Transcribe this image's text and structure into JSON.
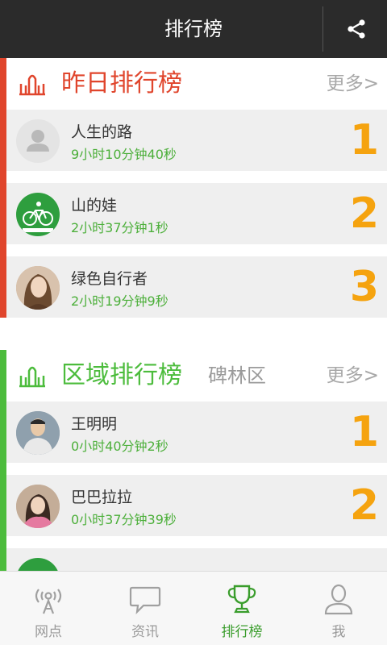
{
  "header": {
    "title": "排行榜",
    "share_icon": "share-icon"
  },
  "yesterday": {
    "title": "昨日排行榜",
    "more": "更多>",
    "accent": "#e0452c",
    "items": [
      {
        "name": "人生的路",
        "time": "9小时10分钟40秒",
        "rank": "1",
        "avatar": "default-avatar"
      },
      {
        "name": "山的娃",
        "time": "2小时37分钟1秒",
        "rank": "2",
        "avatar": "bicycle-avatar"
      },
      {
        "name": "绿色自行者",
        "time": "2小时19分钟9秒",
        "rank": "3",
        "avatar": "photo-avatar"
      }
    ]
  },
  "region": {
    "title": "区域排行榜",
    "area": "碑林区",
    "more": "更多>",
    "accent": "#4cbc3c",
    "items": [
      {
        "name": "王明明",
        "time": "0小时40分钟2秒",
        "rank": "1",
        "avatar": "photo-avatar"
      },
      {
        "name": "巴巴拉拉",
        "time": "0小时37分钟39秒",
        "rank": "2",
        "avatar": "photo-avatar"
      }
    ]
  },
  "tabs": [
    {
      "label": "网点",
      "icon": "signal-icon",
      "active": false
    },
    {
      "label": "资讯",
      "icon": "chat-bubble-icon",
      "active": false
    },
    {
      "label": "排行榜",
      "icon": "trophy-icon",
      "active": true
    },
    {
      "label": "我",
      "icon": "user-icon",
      "active": false
    }
  ],
  "colors": {
    "rank": "#f5a30f",
    "time": "#4caf3a",
    "active_tab": "#3a9d2c",
    "topbar": "#2b2b2b"
  }
}
